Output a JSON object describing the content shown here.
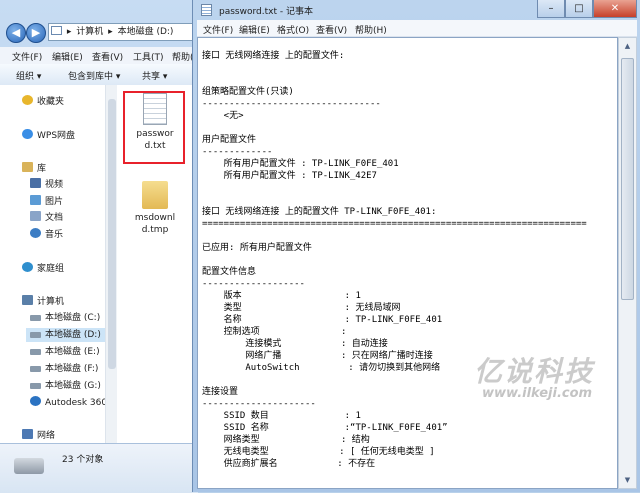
{
  "explorer": {
    "address_parts": [
      "计算机",
      "本地磁盘 (D:)"
    ],
    "menu": [
      "文件(F)",
      "编辑(E)",
      "查看(V)",
      "工具(T)",
      "帮助(H)"
    ],
    "toolbar": [
      "组织 ▾",
      "包含到库中 ▾",
      "共享 ▾"
    ],
    "nav": [
      {
        "label": "收藏夹",
        "icon": "star-icon",
        "color": "#e8b62c"
      },
      {
        "label": "WPS网盘",
        "icon": "cloud-icon",
        "color": "#3a8ee6"
      },
      {
        "label": "库",
        "icon": "library-icon",
        "color": "#d9b35a"
      },
      {
        "label": "视频",
        "icon": "video-icon",
        "color": "#4a6fa5"
      },
      {
        "label": "图片",
        "icon": "picture-icon",
        "color": "#5b9bd5"
      },
      {
        "label": "文档",
        "icon": "document-icon",
        "color": "#8aa4c8"
      },
      {
        "label": "音乐",
        "icon": "music-icon",
        "color": "#3c7dc4"
      },
      {
        "label": "家庭组",
        "icon": "homegroup-icon",
        "color": "#2f8fce"
      },
      {
        "label": "计算机",
        "icon": "computer-icon",
        "color": "#5a7fa8"
      },
      {
        "label": "本地磁盘 (C:)",
        "icon": "drive-icon",
        "color": "#8899aa"
      },
      {
        "label": "本地磁盘 (D:)",
        "icon": "drive-icon",
        "color": "#8899aa"
      },
      {
        "label": "本地磁盘 (E:)",
        "icon": "drive-icon",
        "color": "#8899aa"
      },
      {
        "label": "本地磁盘 (F:)",
        "icon": "drive-icon",
        "color": "#8899aa"
      },
      {
        "label": "本地磁盘 (G:)",
        "icon": "drive-icon",
        "color": "#8899aa"
      },
      {
        "label": "Autodesk 360",
        "icon": "autodesk-icon",
        "color": "#2b73c2"
      },
      {
        "label": "网络",
        "icon": "network-icon",
        "color": "#4d79b3"
      }
    ],
    "files": [
      {
        "name": "password.txt",
        "icon": "text-file-icon"
      },
      {
        "name": "msdownld.tmp",
        "icon": "folder-icon"
      }
    ],
    "status": "23 个对象"
  },
  "notepad": {
    "title": "password.txt - 记事本",
    "menu": [
      "文件(F)",
      "编辑(E)",
      "格式(O)",
      "查看(V)",
      "帮助(H)"
    ],
    "content": "\n接口 无线网络连接 上的配置文件:\n\n\n组策略配置文件(只读)\n---------------------------------\n    <无>\n\n用户配置文件\n-------------\n    所有用户配置文件 : TP-LINK_F0FE_401\n    所有用户配置文件 : TP-LINK_42E7\n\n\n接口 无线网络连接 上的配置文件 TP-LINK_F0FE_401:\n=======================================================================\n\n已应用: 所有用户配置文件\n\n配置文件信息\n-------------------\n    版本                   : 1\n    类型                   : 无线局域网\n    名称                   : TP-LINK_F0FE_401\n    控制选项               :\n        连接模式           : 自动连接\n        网络广播           : 只在网络广播时连接\n        AutoSwitch         : 请勿切换到其他网络\n\n连接设置\n---------------------\n    SSID 数目              : 1\n    SSID 名称              :“TP-LINK_F0FE_401”\n    网络类型               : 结构\n    无线电类型             : [ 任何无线电类型 ]\n    供应商扩展名           : 不存在"
  },
  "watermark": {
    "text_cn": "亿说科技",
    "url": "www.ilkeji.com"
  }
}
